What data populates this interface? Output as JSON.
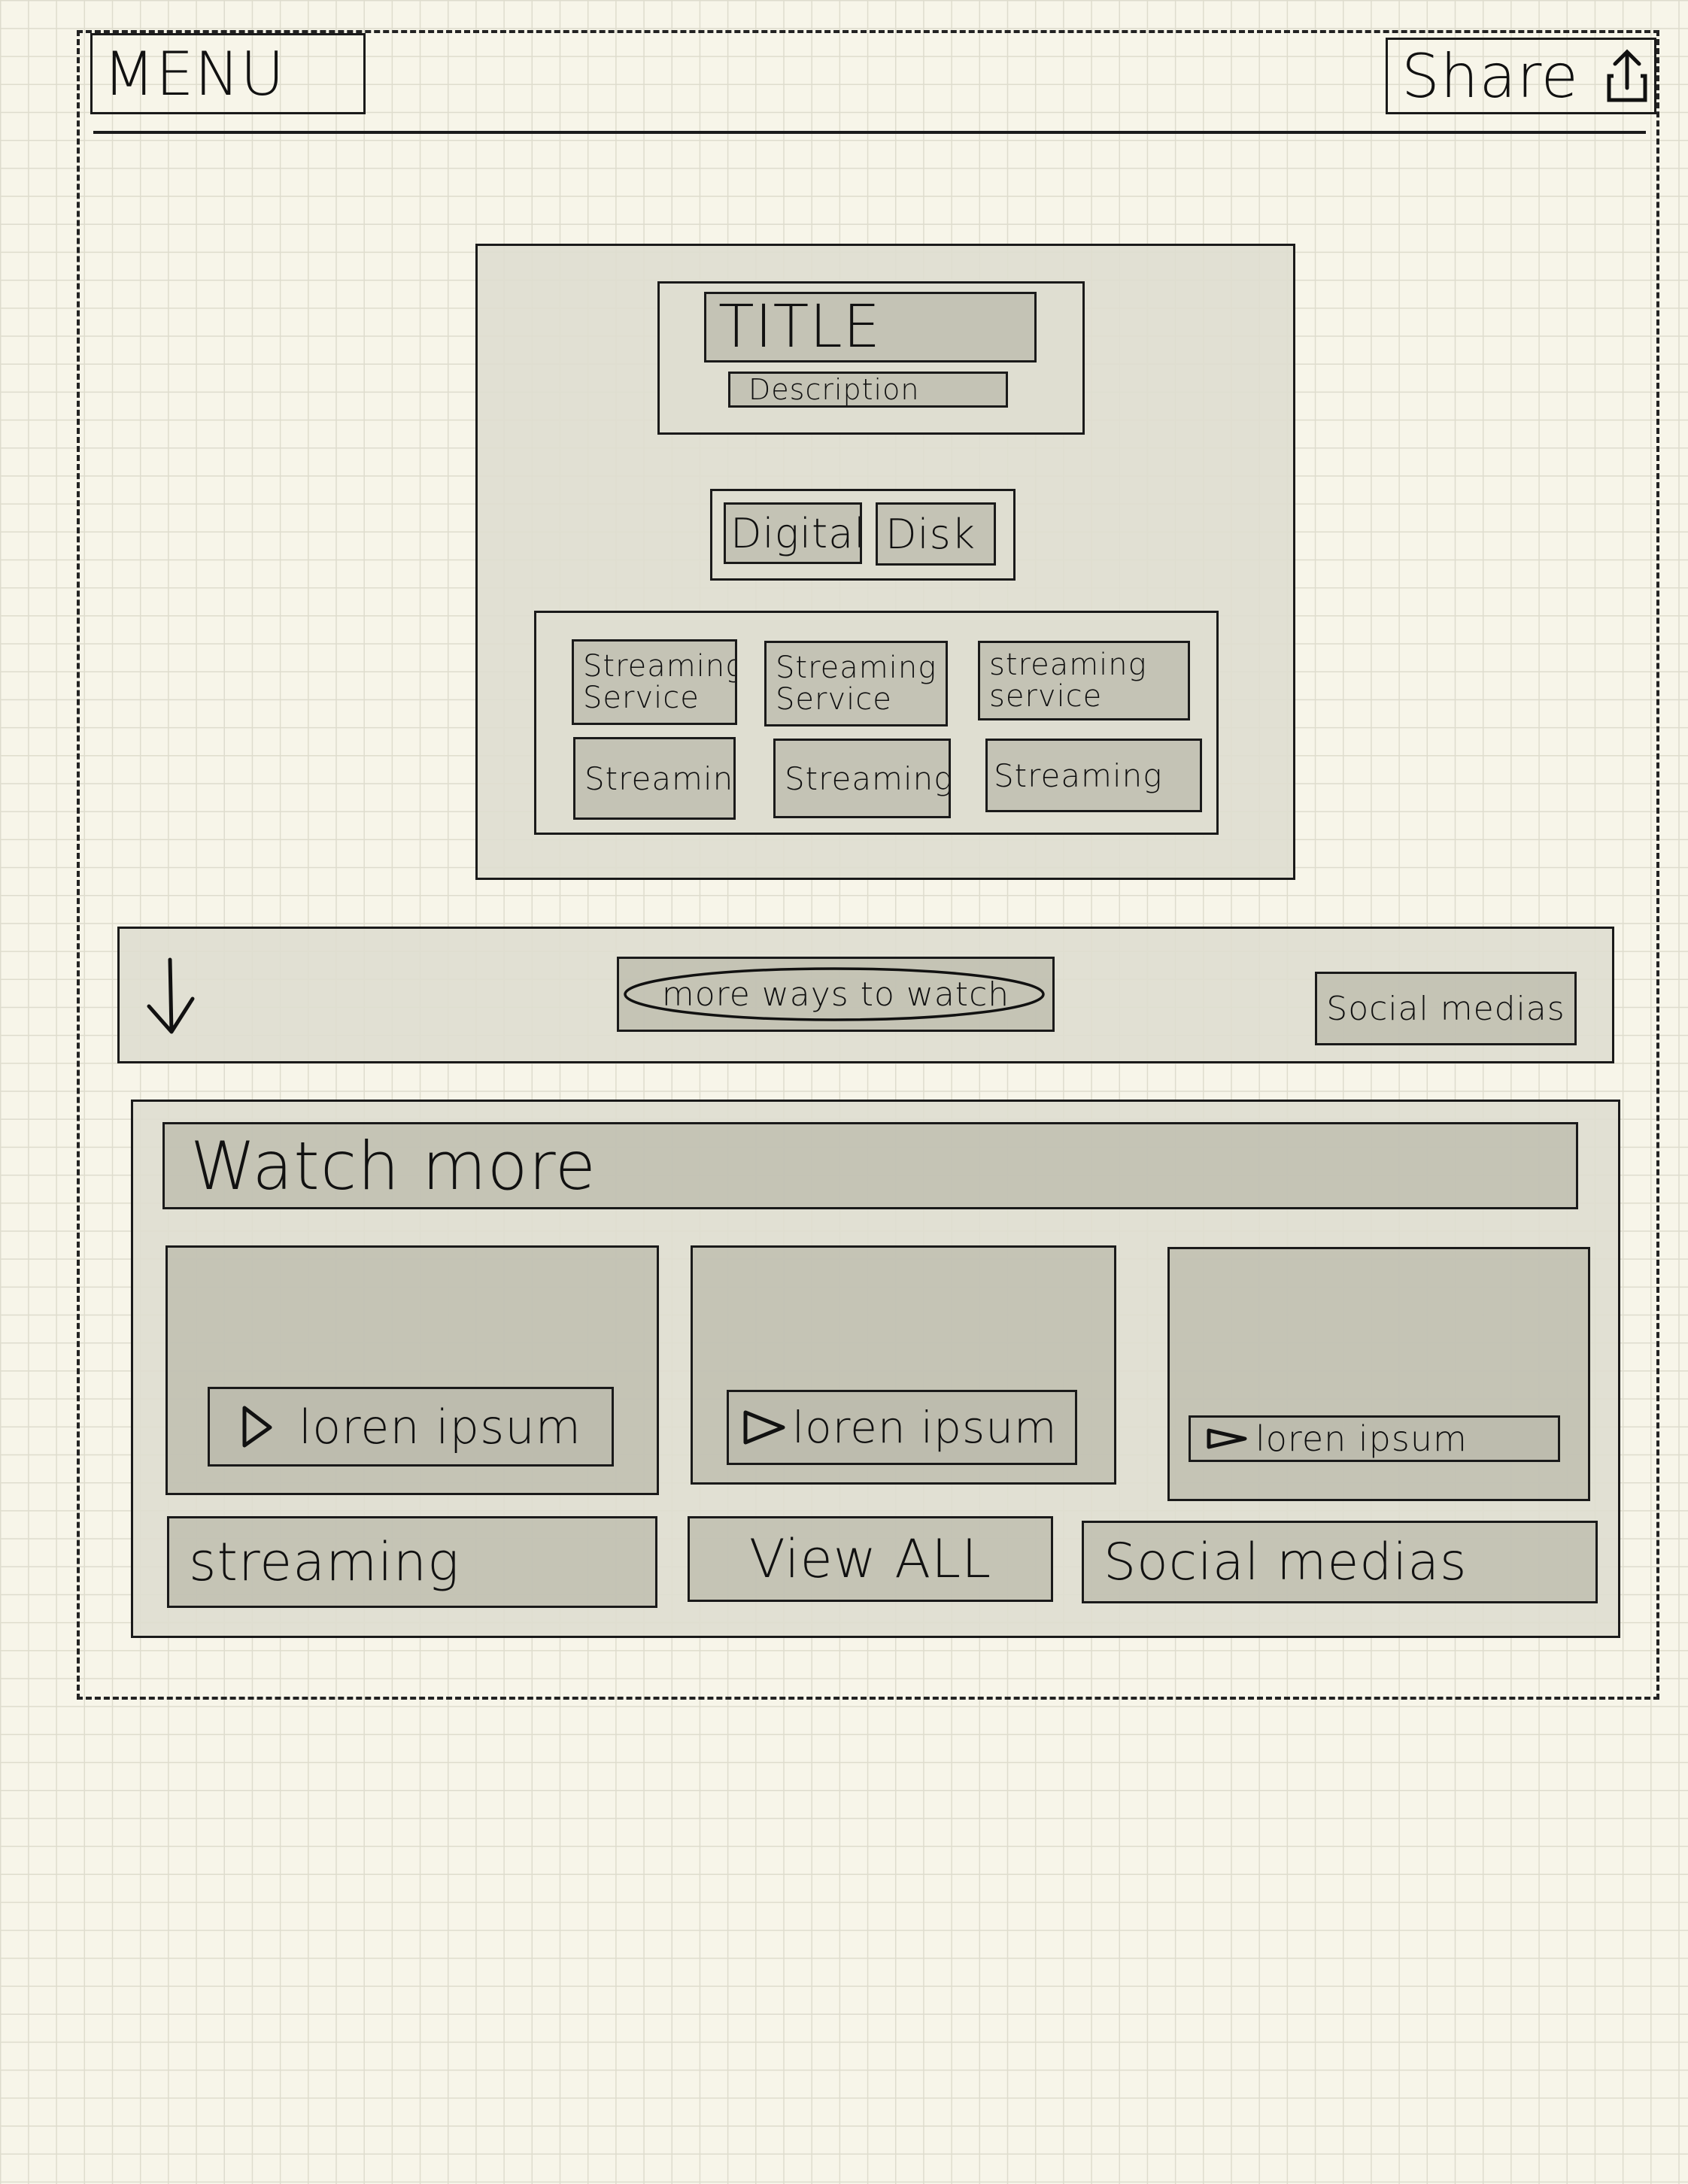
{
  "header": {
    "menu_label": "MENU",
    "share_label": "Share",
    "share_icon": "share-upload-icon"
  },
  "hero": {
    "title": "TITLE",
    "description": "Description",
    "format_tabs": [
      "Digital",
      "Disk"
    ],
    "streaming_services": [
      [
        "Streaming",
        "Service"
      ],
      [
        "Streaming",
        "Service"
      ],
      [
        "streaming",
        "service"
      ]
    ],
    "streaming_links": [
      "Streaming",
      "Streaming",
      "Streaming"
    ]
  },
  "action_bar": {
    "down_icon": "arrow-down-icon",
    "more_ways": "more ways to watch",
    "social": "Social medias"
  },
  "watch_more": {
    "heading": "Watch more",
    "cards": [
      {
        "play_icon": "play-icon",
        "label": "loren ipsum"
      },
      {
        "play_icon": "play-icon",
        "label": "loren ipsum"
      },
      {
        "play_icon": "play-icon",
        "label": "loren ipsum"
      }
    ],
    "footer": {
      "streaming": "streaming",
      "view_all": "View ALL",
      "social": "Social medias"
    }
  }
}
